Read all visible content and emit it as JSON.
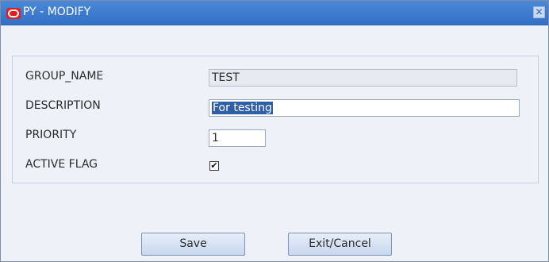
{
  "window": {
    "title": "PY - MODIFY",
    "close_glyph": "✕"
  },
  "form": {
    "group_name": {
      "label": "GROUP_NAME",
      "value": "TEST"
    },
    "description": {
      "label": "DESCRIPTION",
      "value": "For testing"
    },
    "priority": {
      "label": "PRIORITY",
      "value": "1"
    },
    "active_flag": {
      "label": "ACTIVE FLAG",
      "checked": true,
      "glyph": "✔"
    }
  },
  "buttons": {
    "save": "Save",
    "exit": "Exit/Cancel"
  },
  "colors": {
    "titlebar": "#3a78cf",
    "background": "#eef2f8",
    "selection": "#2f5ea8",
    "button": "#d6e2f3"
  },
  "icons": {
    "app_logo": "oracle-logo-icon",
    "close": "close-icon",
    "check": "checkmark-icon"
  }
}
